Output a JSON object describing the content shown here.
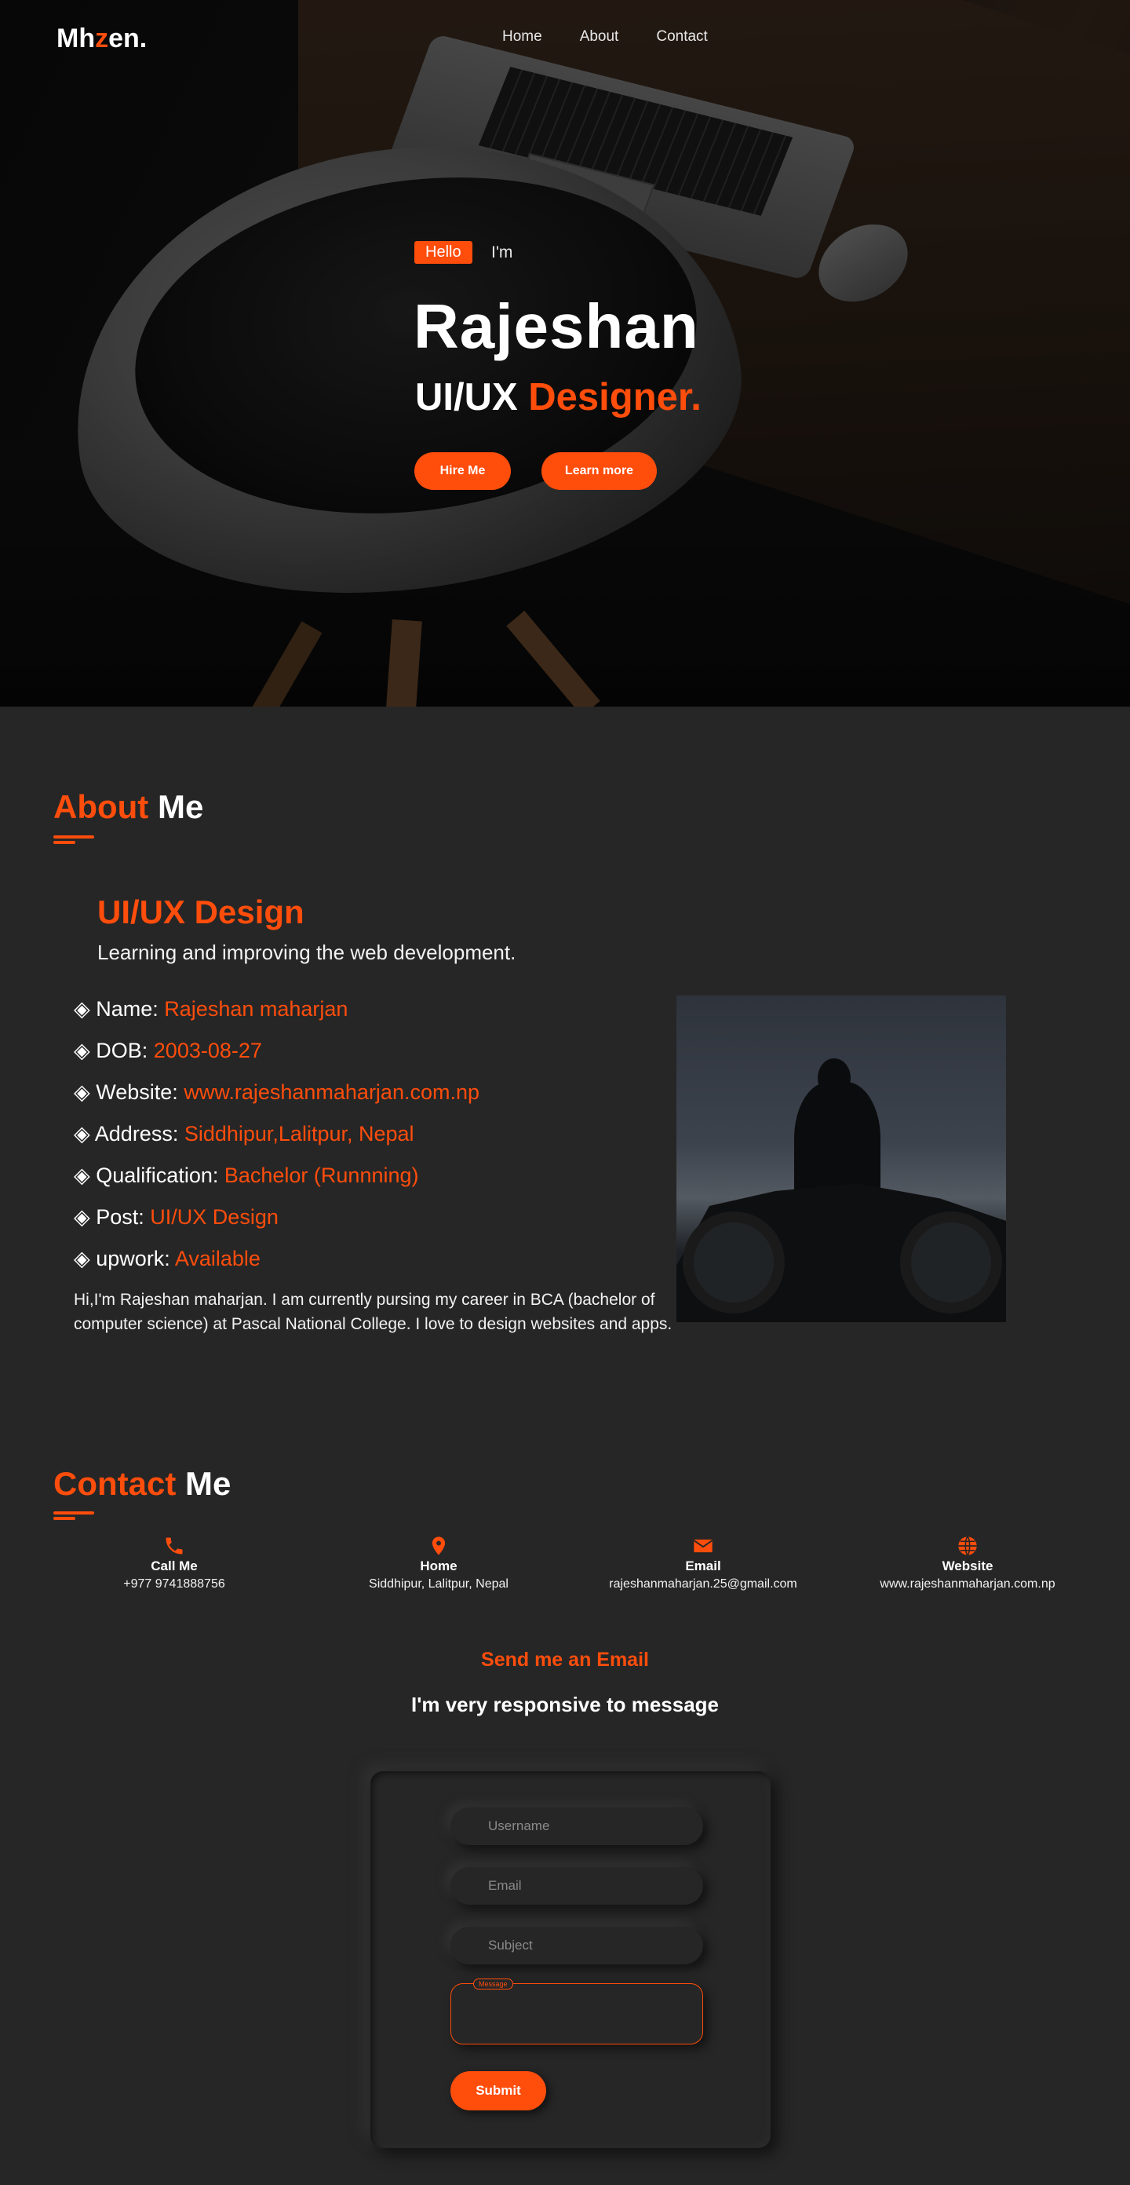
{
  "header": {
    "logo_text": "Mh",
    "logo_accent": "z",
    "logo_tail": "en.",
    "nav": [
      {
        "label": "Home"
      },
      {
        "label": "About"
      },
      {
        "label": "Contact"
      }
    ]
  },
  "hero": {
    "hello_badge": "Hello",
    "intro": "I'm",
    "name": "Rajeshan",
    "role_prefix": "UI/UX ",
    "role_accent": "Designer.",
    "hire_button": "Hire Me",
    "learn_button": "Learn more"
  },
  "about": {
    "title_accent": "About",
    "title_rest": " Me",
    "subtitle": "UI/UX Design",
    "description": "Learning and improving the web development.",
    "details": [
      {
        "label": "◈ Name: ",
        "value": "Rajeshan maharjan"
      },
      {
        "label": "◈ DOB: ",
        "value": "2003-08-27"
      },
      {
        "label": "◈ Website: ",
        "value": "www.rajeshanmaharjan.com.np"
      },
      {
        "label": "◈ Address: ",
        "value": "Siddhipur,Lalitpur, Nepal"
      },
      {
        "label": "◈ Qualification: ",
        "value": "Bachelor (Runnning)"
      },
      {
        "label": "◈ Post: ",
        "value": "UI/UX Design"
      },
      {
        "label": "◈ upwork: ",
        "value": "Available"
      }
    ],
    "bio": "Hi,I'm Rajeshan maharjan. I am currently pursing my career in BCA (bachelor of computer science) at Pascal National College. I love to design websites and apps."
  },
  "contact": {
    "title_accent": "Contact",
    "title_rest": " Me",
    "items": [
      {
        "icon": "phone-icon",
        "label": "Call Me",
        "value": "+977 9741888756"
      },
      {
        "icon": "location-pin-icon",
        "label": "Home",
        "value": "Siddhipur, Lalitpur, Nepal"
      },
      {
        "icon": "envelope-icon",
        "label": "Email",
        "value": "rajeshanmaharjan.25@gmail.com"
      },
      {
        "icon": "globe-icon",
        "label": "Website",
        "value": "www.rajeshanmaharjan.com.np"
      }
    ],
    "send_title": "Send me an Email",
    "send_subtitle": "I'm very responsive to message",
    "form": {
      "username_placeholder": "Username",
      "email_placeholder": "Email",
      "subject_placeholder": "Subject",
      "message_label": "Message",
      "submit_label": "Submit"
    }
  },
  "colors": {
    "accent": "#ff4d0c",
    "background": "#262626"
  }
}
